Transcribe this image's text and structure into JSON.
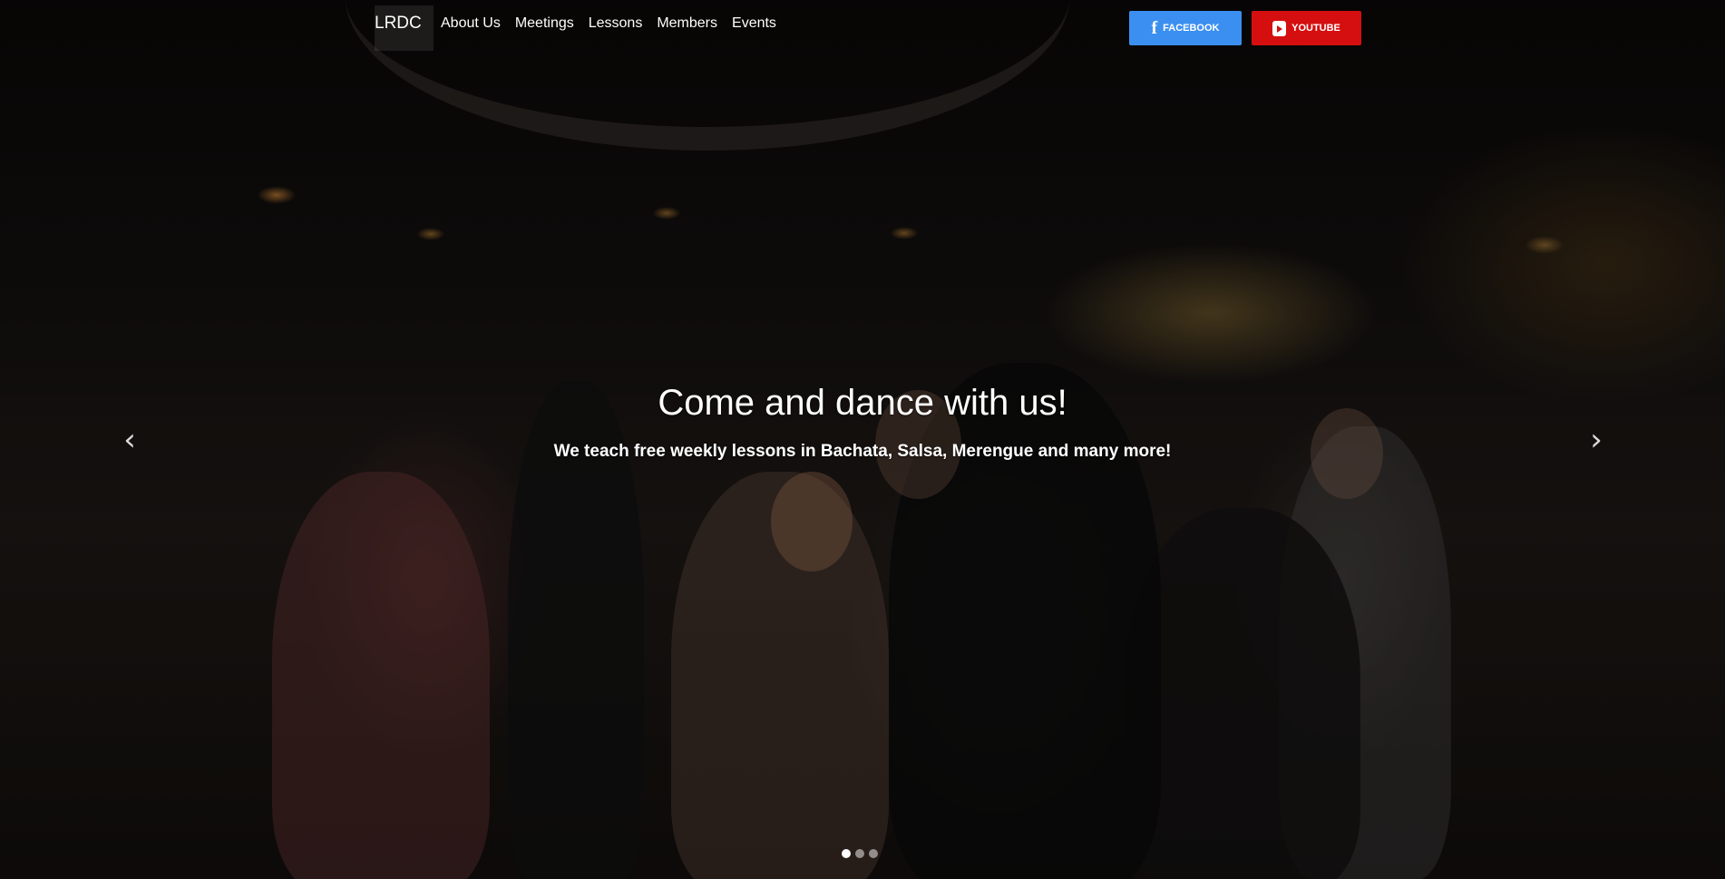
{
  "nav": {
    "brand": "LRDC",
    "links": [
      "About Us",
      "Meetings",
      "Lessons",
      "Members",
      "Events"
    ]
  },
  "social": {
    "facebook": {
      "label": "FACEBOOK",
      "icon": "facebook-icon",
      "color": "#3b8ff0"
    },
    "youtube": {
      "label": "YOUTUBE",
      "icon": "youtube-icon",
      "color": "#d50f0f"
    }
  },
  "hero": {
    "title": "Come and dance with us!",
    "subtitle": "We teach free weekly lessons in Bachata, Salsa, Merengue and many more!",
    "slides_total": 3,
    "active_slide": 1
  },
  "controls": {
    "prev_icon": "chevron-left-icon",
    "next_icon": "chevron-right-icon"
  }
}
